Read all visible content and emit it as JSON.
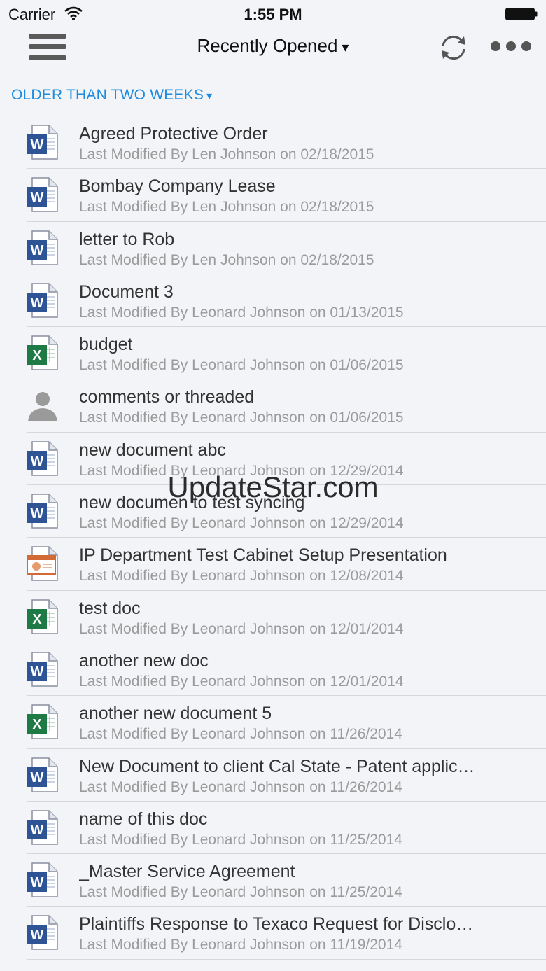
{
  "status_bar": {
    "carrier": "Carrier",
    "time": "1:55 PM"
  },
  "navbar": {
    "title": "Recently Opened",
    "caret": "▾"
  },
  "section": {
    "label": "OLDER THAN TWO WEEKS",
    "caret": "▾",
    "color": "#1d8ce0"
  },
  "documents": [
    {
      "title": "Agreed Protective Order",
      "subtitle": "Last Modified By Len Johnson on 02/18/2015",
      "icon": "word-doc-icon"
    },
    {
      "title": "Bombay Company Lease",
      "subtitle": "Last Modified By Len Johnson on 02/18/2015",
      "icon": "word-doc-icon"
    },
    {
      "title": "letter to Rob",
      "subtitle": "Last Modified By Len Johnson on 02/18/2015",
      "icon": "word-doc-icon"
    },
    {
      "title": "Document 3",
      "subtitle": "Last Modified By Leonard Johnson on 01/13/2015",
      "icon": "word-doc-icon"
    },
    {
      "title": "budget",
      "subtitle": "Last Modified By Leonard Johnson on 01/06/2015",
      "icon": "excel-doc-icon"
    },
    {
      "title": "comments or threaded",
      "subtitle": "Last Modified By Leonard Johnson on 01/06/2015",
      "icon": "person-icon"
    },
    {
      "title": "new document abc",
      "subtitle": "Last Modified By Leonard Johnson on 12/29/2014",
      "icon": "word-doc-icon"
    },
    {
      "title": "new documen to test syncing",
      "subtitle": "Last Modified By Leonard Johnson on 12/29/2014",
      "icon": "word-doc-icon"
    },
    {
      "title": "IP Department Test Cabinet Setup Presentation",
      "subtitle": "Last Modified By Leonard Johnson on 12/08/2014",
      "icon": "powerpoint-doc-icon"
    },
    {
      "title": "test doc",
      "subtitle": "Last Modified By Leonard Johnson on 12/01/2014",
      "icon": "excel-doc-icon"
    },
    {
      "title": "another new doc",
      "subtitle": "Last Modified By Leonard Johnson on 12/01/2014",
      "icon": "word-doc-icon"
    },
    {
      "title": "another new document 5",
      "subtitle": "Last Modified By Leonard Johnson on 11/26/2014",
      "icon": "excel-doc-icon"
    },
    {
      "title": "New Document to client Cal State - Patent applic…",
      "subtitle": "Last Modified By Leonard Johnson on 11/26/2014",
      "icon": "word-doc-icon"
    },
    {
      "title": "name of this doc",
      "subtitle": "Last Modified By Leonard Johnson on 11/25/2014",
      "icon": "word-doc-icon"
    },
    {
      "title": "_Master Service Agreement",
      "subtitle": "Last Modified By Leonard Johnson on 11/25/2014",
      "icon": "word-doc-icon"
    },
    {
      "title": "Plaintiffs Response to Texaco Request for Disclo…",
      "subtitle": "Last Modified By Leonard Johnson on 11/19/2014",
      "icon": "word-doc-icon"
    }
  ],
  "watermark": "UpdateStar.com"
}
